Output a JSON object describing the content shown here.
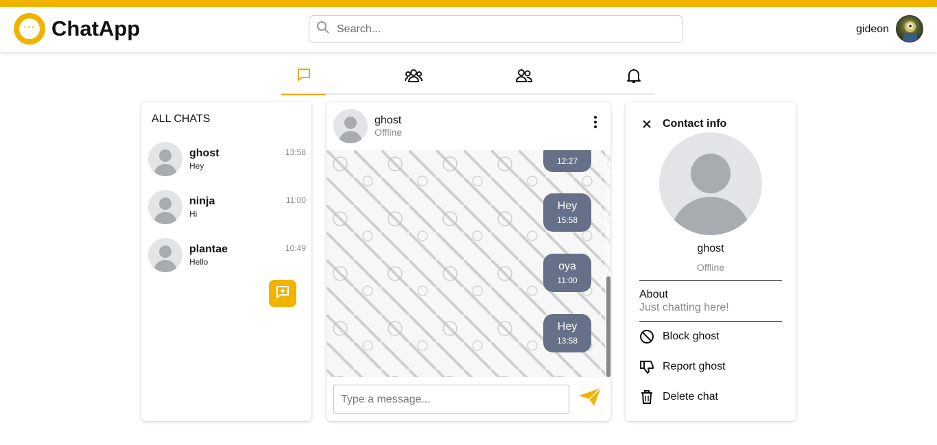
{
  "app": {
    "name": "ChatApp",
    "accent_color": "#f0b400",
    "logo_icon": "chat-bubble-dots-icon",
    "logo_glyph": "···"
  },
  "header": {
    "search": {
      "placeholder": "Search...",
      "value": ""
    },
    "user": {
      "name": "gideon",
      "avatar_icon": "user-avatar"
    }
  },
  "tabs": [
    {
      "icon": "chat-bubble-icon",
      "active": true
    },
    {
      "icon": "group-icon",
      "active": false
    },
    {
      "icon": "contacts-icon",
      "active": false
    },
    {
      "icon": "bell-icon",
      "active": false
    }
  ],
  "chats_panel": {
    "title": "ALL CHATS",
    "items": [
      {
        "name": "ghost",
        "last_message": "Hey",
        "time": "13:58"
      },
      {
        "name": "ninja",
        "last_message": "Hi",
        "time": "11:00"
      },
      {
        "name": "plantae",
        "last_message": "Hello",
        "time": "10:49"
      }
    ],
    "new_chat_icon": "add-chat-icon"
  },
  "conversation": {
    "contact_name": "ghost",
    "contact_status": "Offline",
    "menu_icon": "kebab-menu-icon",
    "bubble_color": "#667089",
    "messages": [
      {
        "text": "",
        "time": "12:27"
      },
      {
        "text": "Hey",
        "time": "15:58"
      },
      {
        "text": "oya",
        "time": "11:00"
      },
      {
        "text": "Hey",
        "time": "13:58"
      }
    ],
    "composer": {
      "placeholder": "Type a message...",
      "value": ""
    },
    "send_icon": "paper-plane-icon"
  },
  "contact_info": {
    "title": "Contact info",
    "name": "ghost",
    "status": "Offline",
    "about_label": "About",
    "about_text": "Just chatting here!",
    "actions": [
      {
        "label": "Block ghost",
        "icon": "block-icon"
      },
      {
        "label": "Report ghost",
        "icon": "thumbs-down-icon"
      },
      {
        "label": "Delete chat",
        "icon": "trash-icon"
      }
    ]
  }
}
